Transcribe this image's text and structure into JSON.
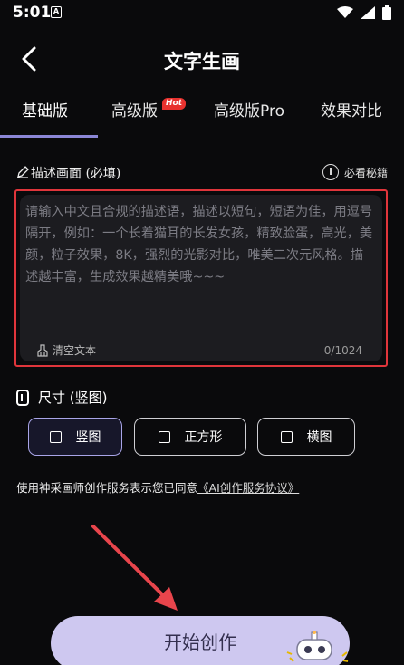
{
  "status_bar": {
    "time": "5:01",
    "app_icon_letter": "A"
  },
  "header": {
    "title": "文字生画"
  },
  "tabs": [
    {
      "label": "基础版",
      "active": true
    },
    {
      "label": "高级版",
      "badge": "Hot"
    },
    {
      "label": "高级版Pro"
    },
    {
      "label": "效果对比"
    }
  ],
  "description": {
    "label": "描述画面 (必填)",
    "tips": "必看秘籍",
    "placeholder": "请输入中文且合规的描述语，描述以短句，短语为佳，用逗号隔开，例如：一个长着猫耳的长发女孩，精致脸蛋，高光，美颜，粒子效果，8K，强烈的光影对比，唯美二次元风格。描述越丰富，生成效果越精美哦~~~",
    "clear_label": "清空文本",
    "char_count": "0/1024"
  },
  "size": {
    "label": "尺寸 (竖图)",
    "options": [
      {
        "label": "竖图",
        "selected": true
      },
      {
        "label": "正方形",
        "selected": false
      },
      {
        "label": "横图",
        "selected": false
      }
    ]
  },
  "agreement": {
    "text": "使用神采画师创作服务表示您已同意",
    "link": "《AI创作服务协议》"
  },
  "start_button": {
    "label": "开始创作"
  },
  "colors": {
    "accent": "#8b86d6",
    "highlight_border": "#e0353b",
    "button_bg": "#cec8f0"
  }
}
